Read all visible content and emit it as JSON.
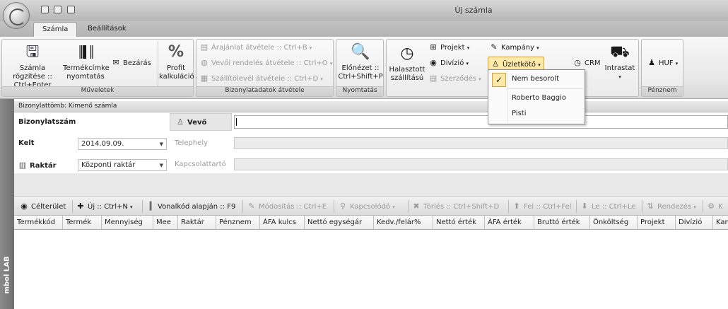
{
  "window": {
    "title": "Új számla"
  },
  "tabs": [
    {
      "label": "Számla"
    },
    {
      "label": "Beállítások"
    }
  ],
  "ribbon": {
    "muveletek": {
      "label": "Műveletek",
      "rogzites": "Számla rögzítése :: Ctrl+Enter",
      "termekcimke": "Termékcímke nyomtatás",
      "bezaras": "Bezárás",
      "profit": "Profit kalkuláció"
    },
    "bizonylat": {
      "label": "Bizonylatadatok átvétele",
      "arajanlat": "Árajánlat átvétele :: Ctrl+B",
      "vevoi": "Vevői rendelés átvétele :: Ctrl+O",
      "szallito": "Szállítólevél átvétele :: Ctrl+D"
    },
    "nyomtatas": {
      "label": "Nyomtatás",
      "elonezet": "Előnézet :: Ctrl+Shift+P"
    },
    "halasztott": "Halasztott szállítású",
    "projekt": "Projekt",
    "divizio": "Divízió",
    "szerzodes": "Szerződés",
    "kampany": "Kampány",
    "uzletkoto": "Üzletkötő",
    "crm": "CRM",
    "intrastat": "Intrastat",
    "penznem": {
      "label": "Pénznem",
      "value": "HUF"
    }
  },
  "dropdown": {
    "items": [
      "Nem besorolt",
      "Roberto Baggio",
      "Pisti"
    ]
  },
  "sidebar": {
    "label": "mbol LAB"
  },
  "block_bar": "Bizonylattömb: Kimenő számla",
  "form": {
    "bizonylatszam_label": "Bizonylatszám",
    "vevo_label": "Vevő",
    "kelt_label": "Kelt",
    "kelt_value": "2014.09.09.",
    "raktar_label": "Raktár",
    "raktar_value": "Központi raktár",
    "telephely_label": "Telephely",
    "kapcsolattarto_label": "Kapcsolattartó"
  },
  "toolbar": {
    "celterulet": "Célterület",
    "uj": "Új :: Ctrl+N",
    "vonalkod": "Vonalkód alapján :: F9",
    "modositas": "Módosítás :: Ctrl+E",
    "kapcsolodo": "Kapcsolódó",
    "torles": "Törlés :: Ctrl+Shift+D",
    "fel": "Fel :: Ctrl+Fel",
    "le": "Le :: Ctrl+Le",
    "rendezes": "Rendezés",
    "k": "K"
  },
  "grid": {
    "columns": [
      "Termékkód",
      "Termék",
      "Mennyiség",
      "Mee",
      "Raktár",
      "Pénznem",
      "ÁFA kulcs",
      "Nettó egységár",
      "Kedv./felár%",
      "Nettó érték",
      "ÁFA érték",
      "Bruttó érték",
      "Önköltség",
      "Projekt",
      "Divízió",
      "Kam"
    ]
  },
  "colors": {
    "accent": "#ffe9a8",
    "ribbon_bg": "#ebebeb",
    "sidebar": "#7a7a7a"
  }
}
